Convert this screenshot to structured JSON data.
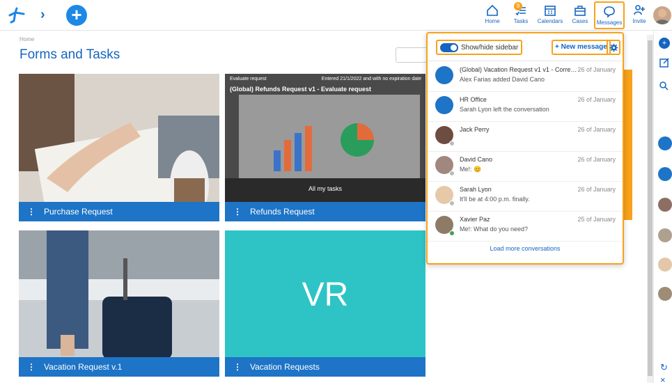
{
  "topnav": {
    "items": [
      {
        "label": "Home",
        "icon": "home-icon"
      },
      {
        "label": "Tasks",
        "icon": "tasks-icon",
        "badge": "9"
      },
      {
        "label": "Calendars",
        "icon": "calendar-icon"
      },
      {
        "label": "Cases",
        "icon": "briefcase-icon"
      },
      {
        "label": "Messages",
        "icon": "chat-icon"
      },
      {
        "label": "Invite",
        "icon": "add-user-icon"
      }
    ]
  },
  "breadcrumb": "Home",
  "page_title": "Forms and Tasks",
  "cards": [
    {
      "label": "Purchase Request"
    },
    {
      "label": "Refunds Request",
      "overlay_header": "Evaluate request",
      "overlay_right": "Entered 21/1/2022 and with no expiration date",
      "overlay_title": "(Global) Refunds Request v1 - Evaluate request",
      "overlay_center": "All my tasks"
    },
    {
      "label": "Vacation Request v.1"
    },
    {
      "label": "Vacation Requests",
      "initials": "VR"
    }
  ],
  "messages_panel": {
    "toggle_label": "Show/hide sidebar",
    "new_message_label": "+ New message",
    "conversations": [
      {
        "name": "(Global) Vacation Request v1 v1 - Correc...",
        "date": "26 of January",
        "message": "Alex Farias added David Cano"
      },
      {
        "name": "HR Office",
        "date": "26 of January",
        "message": "Sarah Lyon left the conversation"
      },
      {
        "name": "Jack Perry",
        "date": "26 of January",
        "message": ""
      },
      {
        "name": "David Cano",
        "date": "26 of January",
        "message": "Me!: 😊"
      },
      {
        "name": "Sarah Lyon",
        "date": "26 of January",
        "message": "It'll be at 4:00 p.m. finally."
      },
      {
        "name": "Xavier Paz",
        "date": "25 of January",
        "message": "Me!: What do you need?"
      }
    ],
    "load_more_label": "Load more conversations"
  },
  "colors": {
    "accent": "#1e74c6",
    "highlight": "#f7a21b",
    "teal": "#2ec4c6"
  }
}
